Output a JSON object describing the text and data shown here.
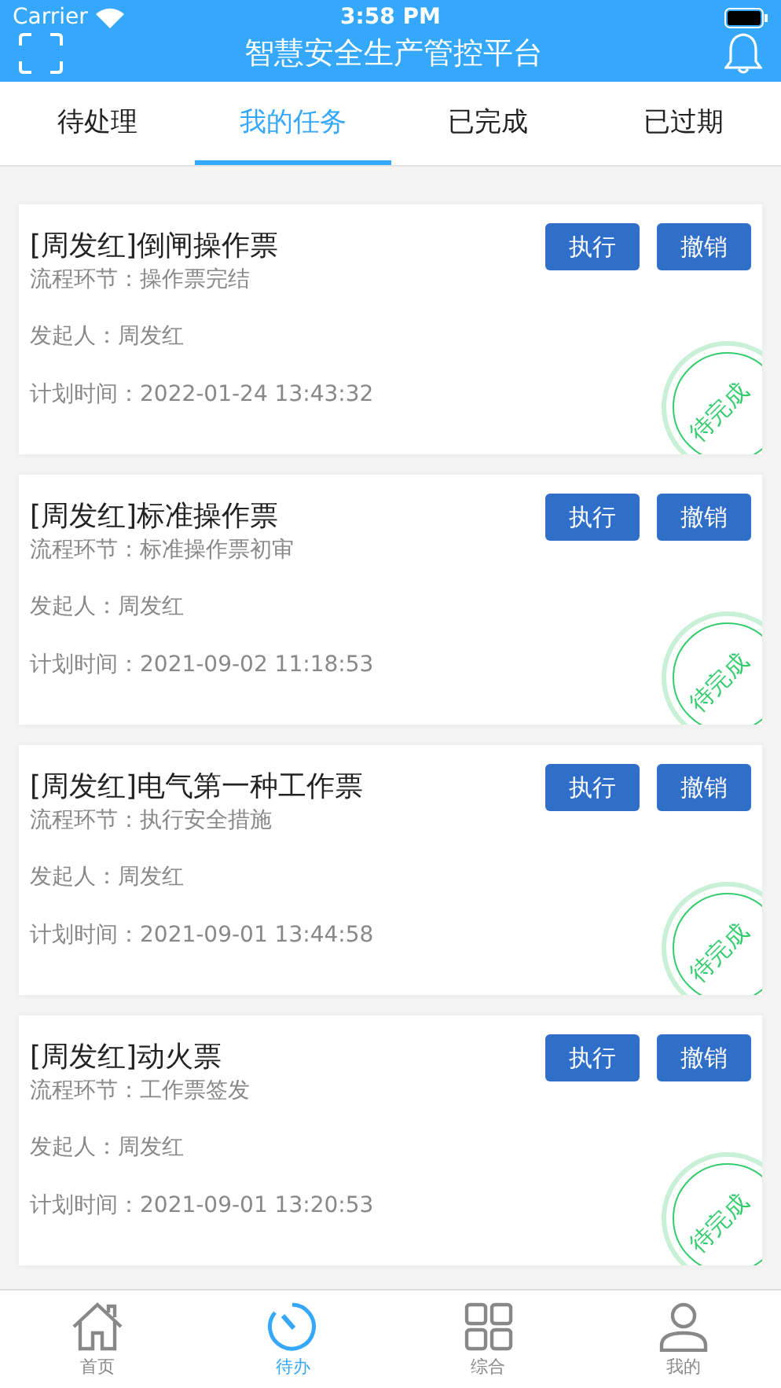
{
  "status_bar": {
    "carrier": "Carrier",
    "time": "3:58 PM"
  },
  "header": {
    "title": "智慧安全生产管控平台"
  },
  "tabs": [
    {
      "label": "待处理",
      "selected": false
    },
    {
      "label": "我的任务",
      "selected": true
    },
    {
      "label": "已完成",
      "selected": false
    },
    {
      "label": "已过期",
      "selected": false
    }
  ],
  "tasks": [
    {
      "title": "[周发红]倒闸操作票",
      "step": "流程环节：操作票完结",
      "initiator": "发起人：周发红",
      "planned_time": "计划时间：2022-01-24 13:43:32",
      "buttons": [
        "执行",
        "撤销"
      ],
      "stamp": "待完成"
    },
    {
      "title": "[周发红]标准操作票",
      "step": "流程环节：标准操作票初审",
      "initiator": "发起人：周发红",
      "planned_time": "计划时间：2021-09-02 11:18:53",
      "buttons": [
        "执行",
        "撤销"
      ],
      "stamp": "待完成"
    },
    {
      "title": "[周发红]电气第一种工作票",
      "step": "流程环节：执行安全措施",
      "initiator": "发起人：周发红",
      "planned_time": "计划时间：2021-09-01 13:44:58",
      "buttons": [
        "执行",
        "撤销"
      ],
      "stamp": "待完成"
    },
    {
      "title": "[周发红]动火票",
      "step": "流程环节：工作票签发",
      "initiator": "发起人：周发红",
      "planned_time": "计划时间：2021-09-01 13:20:53",
      "buttons": [
        "执行",
        "撤销"
      ],
      "stamp": "待完成"
    }
  ],
  "bottom_nav": [
    {
      "label": "首页",
      "kind": "home",
      "selected": false
    },
    {
      "label": "待办",
      "kind": "todo",
      "selected": true
    },
    {
      "label": "综合",
      "kind": "grid",
      "selected": false
    },
    {
      "label": "我的",
      "kind": "profile",
      "selected": false
    }
  ]
}
